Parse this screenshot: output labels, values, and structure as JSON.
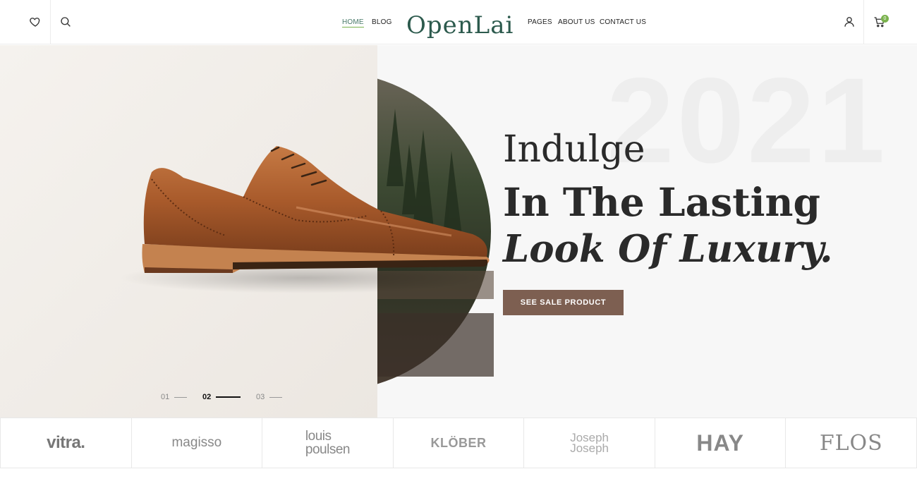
{
  "header": {
    "logo_text": "OpenLai",
    "nav_left": [
      {
        "label": "HOME",
        "active": true
      },
      {
        "label": "BLOG",
        "active": false
      }
    ],
    "nav_right": [
      {
        "label": "PAGES"
      },
      {
        "label": "ABOUT US"
      },
      {
        "label": "CONTACT US"
      }
    ],
    "icons": {
      "wishlist": "heart-icon",
      "search": "search-icon",
      "account": "user-icon",
      "cart": "cart-icon"
    },
    "cart_count": "0",
    "accent_color": "#7ab24d"
  },
  "hero": {
    "watermark_year": "2021",
    "headline_line1": "Indulge",
    "headline_line2": "In The Lasting",
    "headline_line3": "Look Of Luxury.",
    "cta_label": "SEE SALE PRODUCT",
    "cta_color": "#7d5f51",
    "slides": [
      {
        "label": "01",
        "active": false
      },
      {
        "label": "02",
        "active": true
      },
      {
        "label": "03",
        "active": false
      }
    ]
  },
  "brands": [
    {
      "name": "vitra."
    },
    {
      "name": "magisso"
    },
    {
      "name_line1": "louis",
      "name_line2": "poulsen"
    },
    {
      "name": "KLÖBER"
    },
    {
      "name_line1": "Joseph",
      "name_line2": "Joseph"
    },
    {
      "name": "HAY"
    },
    {
      "name": "FLOS"
    }
  ]
}
